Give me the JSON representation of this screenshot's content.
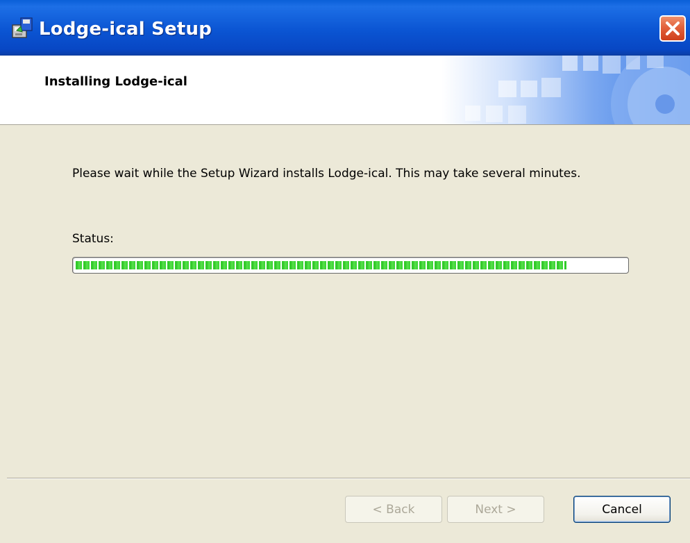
{
  "window": {
    "title": "Lodge-ical Setup"
  },
  "banner": {
    "title": "Installing Lodge-ical"
  },
  "content": {
    "description": "Please wait while the Setup Wizard installs Lodge-ical.  This may take several minutes.",
    "status_label": "Status:",
    "progress_percent": 89
  },
  "buttons": {
    "back": "< Back",
    "next": "Next >",
    "cancel": "Cancel"
  },
  "icons": {
    "app": "installer-icon",
    "close": "close-icon"
  },
  "colors": {
    "titlebar": "#0b55d3",
    "progress": "#35d12f",
    "close": "#e2613c",
    "background": "#ece9d8"
  }
}
